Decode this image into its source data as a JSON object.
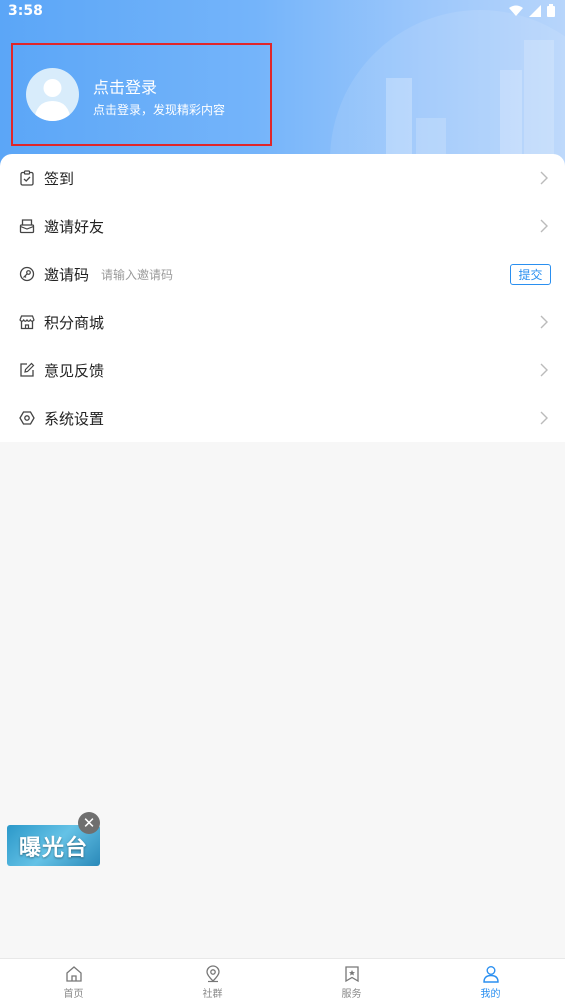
{
  "status_bar": {
    "time": "3:58"
  },
  "profile": {
    "title": "点击登录",
    "subtitle": "点击登录，发现精彩内容"
  },
  "menu": {
    "items": [
      {
        "label": "签到",
        "icon": "checkin-icon"
      },
      {
        "label": "邀请好友",
        "icon": "invite-icon"
      },
      {
        "label": "邀请码",
        "icon": "key-icon",
        "placeholder": "请输入邀请码",
        "button": "提交"
      },
      {
        "label": "积分商城",
        "icon": "store-icon"
      },
      {
        "label": "意见反馈",
        "icon": "edit-icon"
      },
      {
        "label": "系统设置",
        "icon": "settings-icon"
      }
    ]
  },
  "floating_banner": {
    "text": "曝光台"
  },
  "tabbar": {
    "tabs": [
      {
        "label": "首页",
        "icon": "home-icon"
      },
      {
        "label": "社群",
        "icon": "location-icon"
      },
      {
        "label": "服务",
        "icon": "bookmark-star-icon"
      },
      {
        "label": "我的",
        "icon": "person-icon",
        "active": true
      }
    ]
  },
  "colors": {
    "accent": "#2a8ff0",
    "highlight_border": "#e0262a"
  }
}
